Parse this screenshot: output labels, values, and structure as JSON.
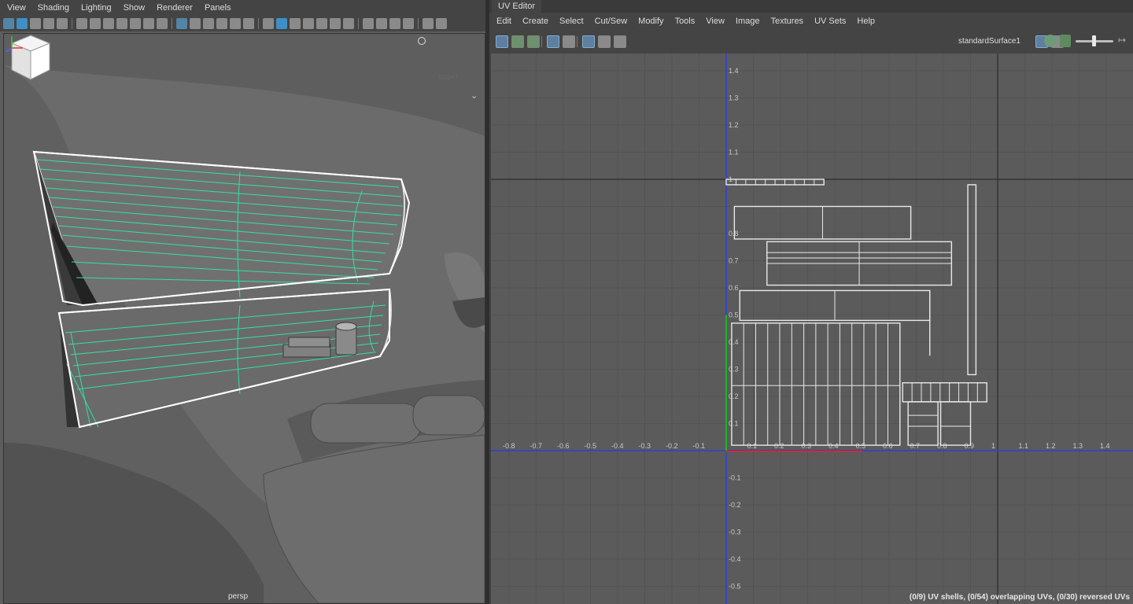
{
  "left_panel": {
    "menu": [
      "View",
      "Shading",
      "Lighting",
      "Show",
      "Renderer",
      "Panels"
    ],
    "view_cube_label": "RIGHT",
    "camera_label": "persp"
  },
  "uv_editor": {
    "tab_title": "UV Editor",
    "menu": [
      "Edit",
      "Create",
      "Select",
      "Cut/Sew",
      "Modify",
      "Tools",
      "View",
      "Image",
      "Textures",
      "UV Sets",
      "Help"
    ],
    "material_name": "standardSurface1",
    "status_text": "(0/9) UV shells, (0/54) overlapping UVs, (0/30) reversed UVs",
    "axis_labels": {
      "u_axis": [
        "-0.8",
        "-0.7",
        "-0.6",
        "-0.5",
        "-0.4",
        "-0.3",
        "-0.2",
        "-0.1",
        "0.1",
        "0.2",
        "0.3",
        "0.4",
        "0.5",
        "0.6",
        "0.7",
        "0.8",
        "0.9",
        "1",
        "1.1",
        "1.2",
        "1.3",
        "1.4"
      ],
      "v_axis": [
        "1.4",
        "1.3",
        "1.2",
        "1.1",
        "1",
        "0.8",
        "0.7",
        "0.6",
        "0.5",
        "0.4",
        "0.3",
        "0.2",
        "0.1",
        "-0.1",
        "-0.2",
        "-0.3",
        "-0.4",
        "-0.5"
      ]
    }
  },
  "colors": {
    "wireframe_highlight": "#35e0a0",
    "uv_u_axis": "#2f3fd8",
    "uv_v_axis": "#1db32d",
    "uv_origin_u": "#d42a2a",
    "uv_shell_lines": "#e8e8e8"
  }
}
